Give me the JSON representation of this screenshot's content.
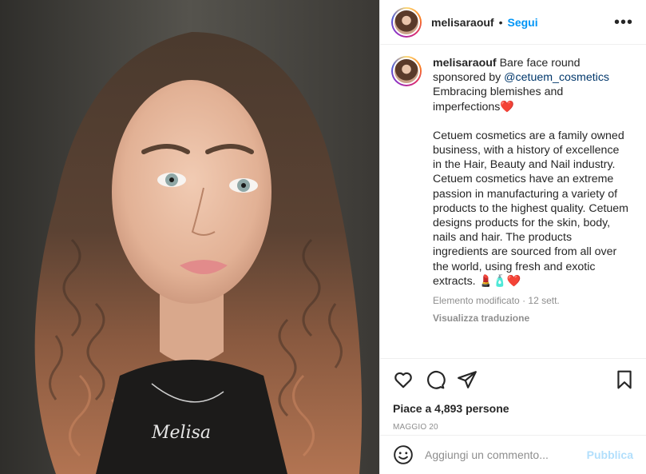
{
  "post": {
    "username": "melisaraouf",
    "separator": "•",
    "follow_label": "Segui",
    "more_label": "•••"
  },
  "caption": {
    "username": "melisaraouf",
    "text_before_mention": "Bare face round sponsored by ",
    "mention": "@cetuem_cosmetics",
    "text_after_mention": " Embracing blemishes and imperfections",
    "emoji_heart": "❤️",
    "paragraph": "Cetuem cosmetics are a family owned business, with a history of excellence in the Hair, Beauty and Nail industry. Cetuem cosmetics have an extreme passion in manufacturing a variety of products to the highest quality. Cetuem designs products for the skin, body, nails and hair. The products ingredients are sourced from all over the world, using fresh and exotic extracts. ",
    "paragraph_emojis": "💄🧴❤️",
    "edited_label": "Elemento modificato",
    "meta_separator": " · ",
    "time_ago": "12 sett.",
    "translate_label": "Visualizza traduzione"
  },
  "actions": {
    "like_icon": "heart-outline-icon",
    "comment_icon": "comment-icon",
    "share_icon": "paper-plane-icon",
    "save_icon": "bookmark-icon"
  },
  "likes": {
    "label": "Piace a 4,893 persone"
  },
  "date": "MAGGIO 20",
  "comment": {
    "placeholder": "Aggiungi un commento...",
    "publish_label": "Pubblica"
  },
  "photo": {
    "necklace_text": "Melisa"
  },
  "colors": {
    "link_blue": "#0095f6",
    "mention_blue": "#00376b",
    "publish_disabled": "#b2dffc",
    "muted": "#8e8e8e"
  }
}
